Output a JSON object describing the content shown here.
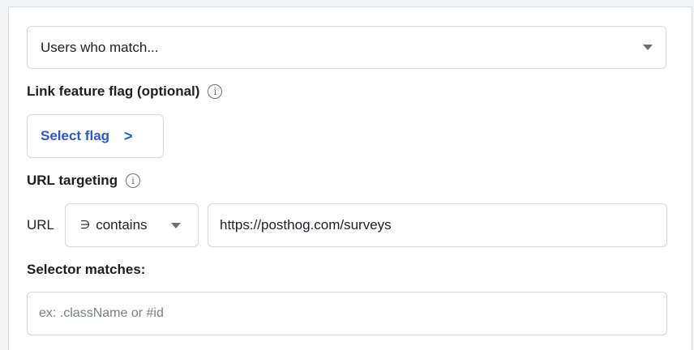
{
  "audience": {
    "selected": "Users who match..."
  },
  "feature_flag": {
    "label": "Link feature flag (optional)",
    "info_glyph": "i",
    "button_label": "Select flag",
    "button_chevron": ">"
  },
  "url_targeting": {
    "label": "URL targeting",
    "info_glyph": "i",
    "row_label": "URL",
    "operator_symbol": "∋",
    "operator": "contains",
    "value": "https://posthog.com/surveys"
  },
  "selector": {
    "label": "Selector matches:",
    "placeholder": "ex: .className or #id",
    "value": ""
  },
  "colors": {
    "link_blue": "#2b57d6",
    "border": "#d6d8de",
    "text": "#1d1f27",
    "muted": "#6b7080"
  },
  "icons": {
    "dropdown": "chevron-down-icon",
    "info": "info-icon",
    "flag_chevron": "chevron-right-icon"
  }
}
